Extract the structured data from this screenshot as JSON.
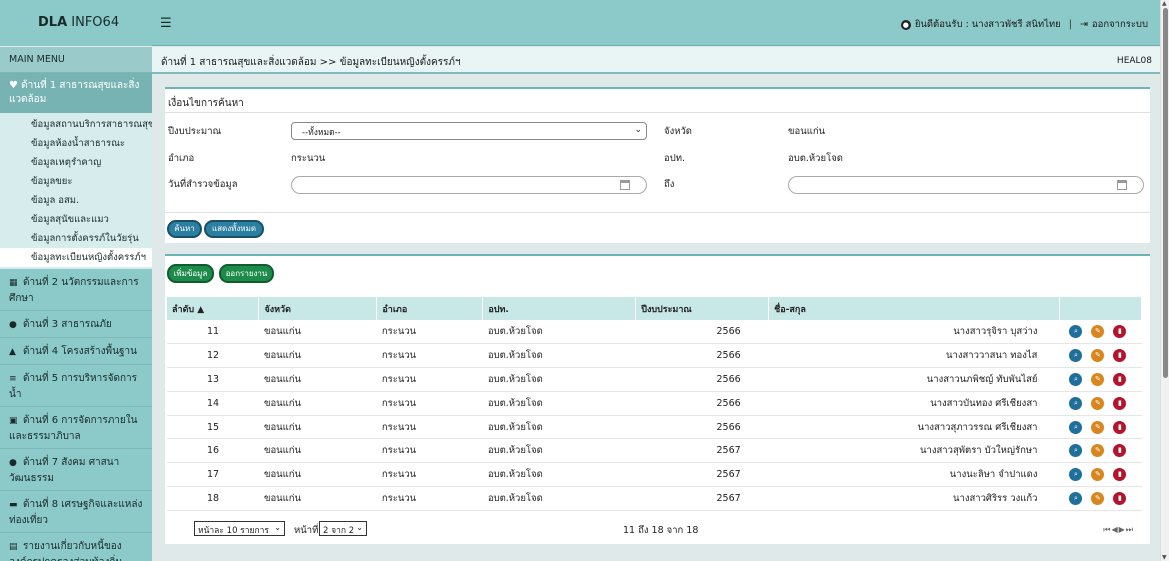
{
  "topbar": {
    "brand_bold": "DLA",
    "brand_rest": " INFO64",
    "welcome": "ยินดีต้อนรับ : นางสาวพัชรี สนิทไทย",
    "logout": "ออกจากระบบ"
  },
  "sidebar": {
    "title": "MAIN MENU",
    "active": "ด้านที่ 1 สาธารณสุขและสิ่งแวดล้อม",
    "subitems": [
      "ข้อมูลสถานบริการสาธารณสุข",
      "ข้อมูลห้องน้ำสาธารณะ",
      "ข้อมูลเหตุรำคาญ",
      "ข้อมูลขยะ",
      "ข้อมูล อสม.",
      "ข้อมูลสุนัขและแมว",
      "ข้อมูลการตั้งครรภ์ในวัยรุ่น",
      "ข้อมูลทะเบียนหญิงตั้งครรภ์ฯ"
    ],
    "items": [
      "ด้านที่ 2 นวัตกรรมและการศึกษา",
      "ด้านที่ 3 สาธารณภัย",
      "ด้านที่ 4 โครงสร้างพื้นฐาน",
      "ด้านที่ 5 การบริหารจัดการน้ำ",
      "ด้านที่ 6 การจัดการภายในและธรรมาภิบาล",
      "ด้านที่ 7 สังคม ศาสนา วัฒนธรรม",
      "ด้านที่ 8 เศรษฐกิจและแหล่งท่องเที่ยว",
      "รายงานเกี่ยวกับหนี้ขององค์กรปกครองส่วนท้องถิ่น"
    ]
  },
  "header": {
    "breadcrumb": "ด้านที่ 1 สาธารณสุขและสิ่งแวดล้อม >>  ข้อมูลทะเบียนหญิงตั้งครรภ์ฯ",
    "code": "HEAL08"
  },
  "search": {
    "title": "เงื่อนไขการค้นหา",
    "budget_year_label": "ปีงบประมาณ",
    "budget_year_value": "--ทั้งหมด--",
    "province_label": "จังหวัด",
    "province_value": "ขอนแก่น",
    "district_label": "อำเภอ",
    "district_value": "กระนวน",
    "lao_label": "อปท.",
    "lao_value": "อบต.ห้วยโจด",
    "date_label": "วันที่สำรวจข้อมูล",
    "to_label": "ถึง",
    "search_btn": "ค้นหา",
    "show_all_btn": "แสดงทั้งหมด"
  },
  "data_panel": {
    "add_btn": "เพิ่มข้อมูล",
    "export_btn": "ออกรายงาน",
    "columns": [
      "ลำดับ ▲",
      "จังหวัด",
      "อำเภอ",
      "อปท.",
      "ปีงบประมาณ",
      "ชื่อ-สกุล",
      ""
    ],
    "rows": [
      {
        "no": "11",
        "province": "ขอนแก่น",
        "district": "กระนวน",
        "lao": "อบต.ห้วยโจด",
        "year": "2566",
        "name": "นางสาวรุจิรา บุสว่าง"
      },
      {
        "no": "12",
        "province": "ขอนแก่น",
        "district": "กระนวน",
        "lao": "อบต.ห้วยโจด",
        "year": "2566",
        "name": "นางสาววาสนา ทองไส"
      },
      {
        "no": "13",
        "province": "ขอนแก่น",
        "district": "กระนวน",
        "lao": "อบต.ห้วยโจด",
        "year": "2566",
        "name": "นางสาวนภพิชญ์ ทับพันไสย์"
      },
      {
        "no": "14",
        "province": "ขอนแก่น",
        "district": "กระนวน",
        "lao": "อบต.ห้วยโจด",
        "year": "2566",
        "name": "นางสาวบันทอง ศรีเชียงสา"
      },
      {
        "no": "15",
        "province": "ขอนแก่น",
        "district": "กระนวน",
        "lao": "อบต.ห้วยโจด",
        "year": "2566",
        "name": "นางสาวสุภาวรรณ ศรีเชียงสา"
      },
      {
        "no": "16",
        "province": "ขอนแก่น",
        "district": "กระนวน",
        "lao": "อบต.ห้วยโจด",
        "year": "2567",
        "name": "นางสาวสุพัตรา บัวใหญ่รักษา"
      },
      {
        "no": "17",
        "province": "ขอนแก่น",
        "district": "กระนวน",
        "lao": "อบต.ห้วยโจด",
        "year": "2567",
        "name": "นางนะลิษา จำปาแดง"
      },
      {
        "no": "18",
        "province": "ขอนแก่น",
        "district": "กระนวน",
        "lao": "อบต.ห้วยโจด",
        "year": "2567",
        "name": "นางสาวศิริรร วงแก้ว"
      }
    ],
    "per_page": "หน้าละ 10 รายการ",
    "page_label": "หน้าที่",
    "page_value": "2 จาก 2",
    "range_text": "11 ถึง 18 จาก 18",
    "nav_icons": "⏮◀▶⏭"
  },
  "icons": {
    "row_actions": [
      "search-icon",
      "edit-icon",
      "delete-icon"
    ]
  }
}
